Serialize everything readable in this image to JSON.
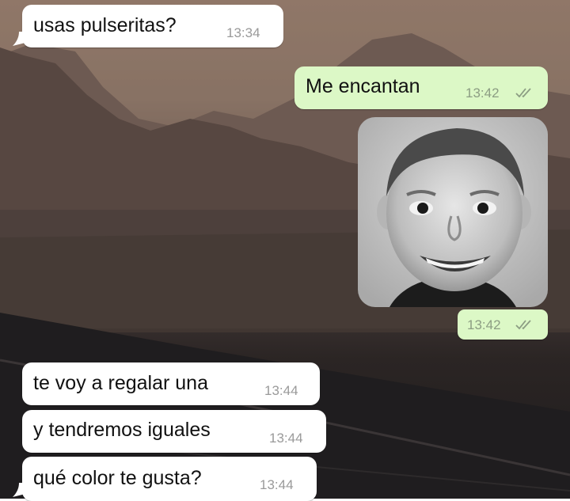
{
  "conversation": {
    "messages": [
      {
        "text": "usas pulseritas?",
        "time": "13:34",
        "direction": "incoming"
      },
      {
        "text": "Me encantan",
        "time": "13:42",
        "direction": "outgoing",
        "status": "read-double-check-icon"
      },
      {
        "media": "photo",
        "time": "13:42",
        "direction": "outgoing",
        "status": "read-double-check-icon"
      },
      {
        "text": "te voy a regalar una",
        "time": "13:44",
        "direction": "incoming"
      },
      {
        "text": "y tendremos iguales",
        "time": "13:44",
        "direction": "incoming"
      },
      {
        "text": "qué color te gusta?",
        "time": "13:44",
        "direction": "incoming"
      }
    ]
  },
  "colors": {
    "incoming_bubble": "#ffffff",
    "outgoing_bubble": "#dcf8c6",
    "time_text": "#9a9a9a"
  }
}
